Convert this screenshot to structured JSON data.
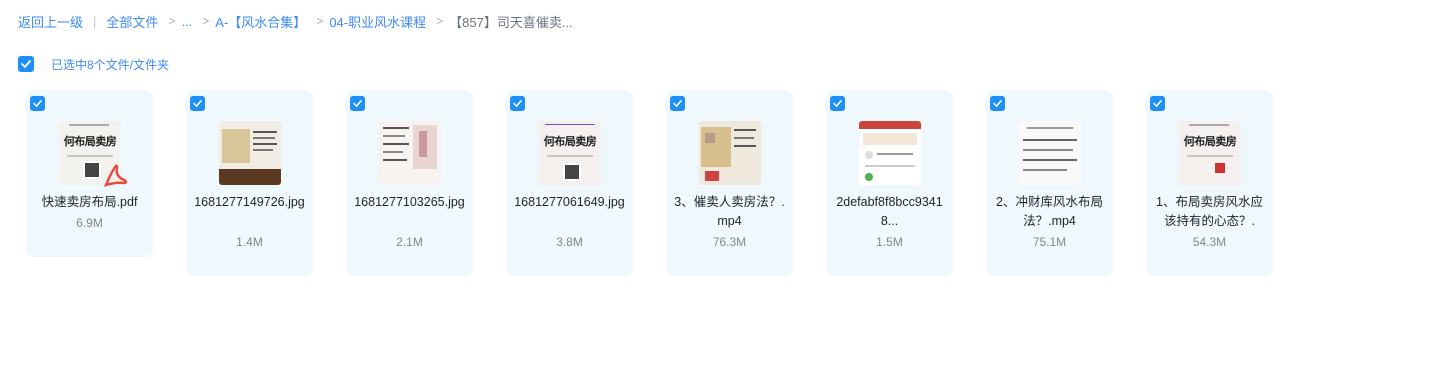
{
  "breadcrumb": {
    "back": "返回上一级",
    "all_files": "全部文件",
    "ellipsis": "...",
    "level1": "A-【风水合集】",
    "level2": "04-职业风水课程",
    "current": "【857】司天喜催卖..."
  },
  "selection": {
    "label": "已选中8个文件/文件夹"
  },
  "thumb_text": {
    "big": "何布局卖房"
  },
  "files": [
    {
      "name": "快速卖房布局.pdf",
      "size": "6.9M",
      "selected": true,
      "type": "pdf"
    },
    {
      "name": "1681277149726.jpg",
      "size": "1.4M",
      "selected": true,
      "type": "jpg"
    },
    {
      "name": "1681277103265.jpg",
      "size": "2.1M",
      "selected": true,
      "type": "jpg"
    },
    {
      "name": "1681277061649.jpg",
      "size": "3.8M",
      "selected": true,
      "type": "jpg"
    },
    {
      "name": "3、催卖人卖房法？.mp4",
      "size": "76.3M",
      "selected": true,
      "type": "mp4"
    },
    {
      "name": "2defabf8f8bcc93418...",
      "size": "1.5M",
      "selected": true,
      "type": "jpg"
    },
    {
      "name": "2、冲财库风水布局法？.mp4",
      "size": "75.1M",
      "selected": true,
      "type": "mp4"
    },
    {
      "name": "1、布局卖房风水应该持有的心态？.",
      "size": "54.3M",
      "selected": true,
      "type": "mp4"
    }
  ],
  "colors": {
    "accent": "#1e8ff6",
    "link": "#3d8af7",
    "card_bg": "#eff8fd"
  }
}
